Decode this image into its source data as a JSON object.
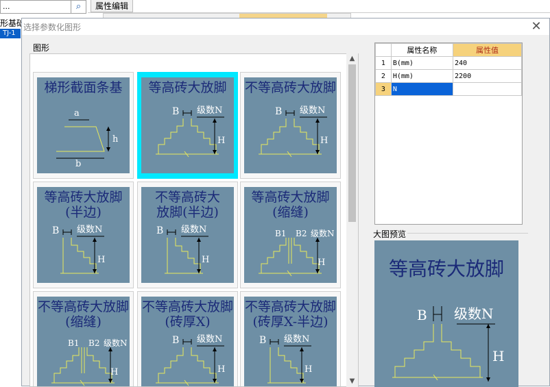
{
  "background": {
    "search_value": "...",
    "search_icon": "search-icon",
    "tree_label": "形基础",
    "tree_selected": "TJ-1",
    "props_tab": "属性编辑"
  },
  "dialog": {
    "title": "选择参数化图形",
    "close_icon": "close-icon",
    "group_label": "图形",
    "shapes": [
      {
        "caption": "梯形截面条基",
        "labels": [
          "a",
          "h",
          "b"
        ]
      },
      {
        "caption": "等高砖大放脚",
        "labels": [
          "B",
          "级数N",
          "H"
        ]
      },
      {
        "caption": "不等高砖大放脚",
        "labels": [
          "B",
          "级数N",
          "H"
        ]
      },
      {
        "caption": "等高砖大放脚\n(半边)",
        "labels": [
          "B",
          "级数N",
          "H"
        ]
      },
      {
        "caption": "不等高砖大\n放脚(半边)",
        "labels": [
          "B",
          "级数N",
          "H"
        ]
      },
      {
        "caption": "等高砖大放脚\n(缩缝)",
        "labels": [
          "B1",
          "B2",
          "级数N",
          "H"
        ]
      },
      {
        "caption": "不等高砖大放脚\n(缩缝)",
        "labels": [
          "B1",
          "B2",
          "级数N",
          "H"
        ]
      },
      {
        "caption": "不等高砖大放脚\n(砖厚X)",
        "labels": [
          "B",
          "级数N",
          "H"
        ]
      },
      {
        "caption": "不等高砖大放脚\n(砖厚X-半边)",
        "labels": [
          "B",
          "级数N",
          "H"
        ]
      }
    ],
    "selected_index": 1,
    "props": {
      "col_name": "属性名称",
      "col_value": "属性值",
      "rows": [
        {
          "num": "1",
          "name": "B(mm)",
          "value": "240"
        },
        {
          "num": "2",
          "name": "H(mm)",
          "value": "2200"
        },
        {
          "num": "3",
          "name": "N",
          "value": ""
        }
      ]
    },
    "preview_label": "大图预览",
    "preview": {
      "caption": "等高砖大放脚",
      "labels": [
        "B",
        "级数N",
        "H"
      ]
    }
  }
}
